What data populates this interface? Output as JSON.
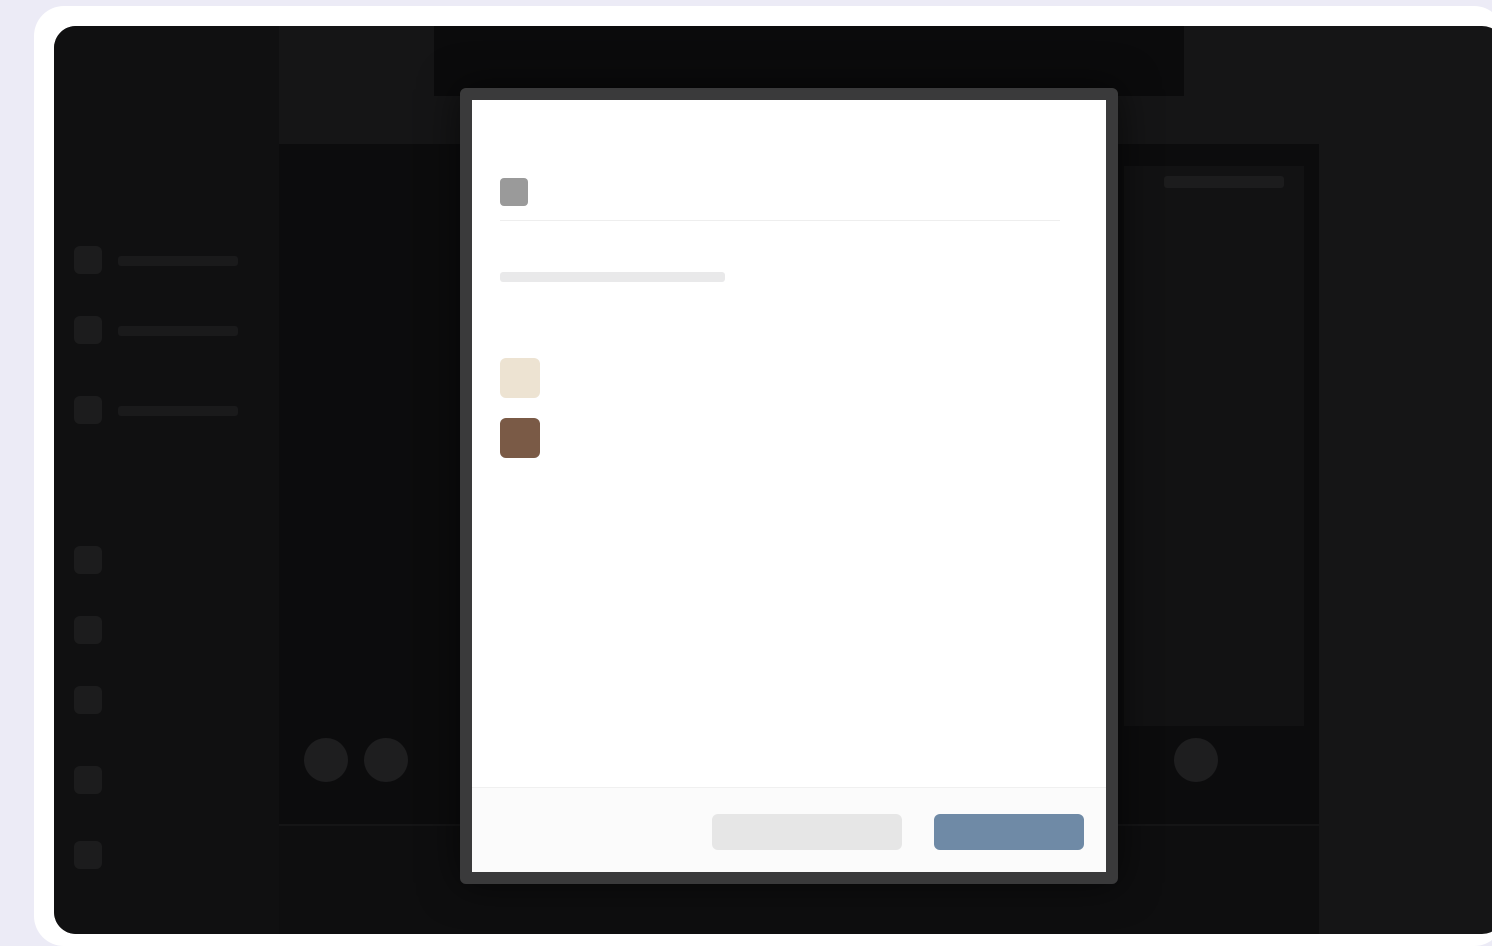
{
  "dialog": {
    "title": "",
    "app_name": "",
    "app_meta": "",
    "section_a_label": "",
    "section_b_label": "",
    "permissions": [
      {
        "label": "",
        "state": "",
        "icon": "beige-app-icon",
        "color": "#ede3d2"
      },
      {
        "label": "",
        "state": "",
        "icon": "brown-app-icon",
        "color": "#7a5a46"
      }
    ],
    "cancel_label": "",
    "confirm_label": ""
  },
  "colors": {
    "page_background": "#ecebf6",
    "screen_background": "#151516",
    "dialog_background": "#ffffff",
    "primary_button": "#6f8aa6",
    "secondary_button": "#e6e6e6"
  }
}
